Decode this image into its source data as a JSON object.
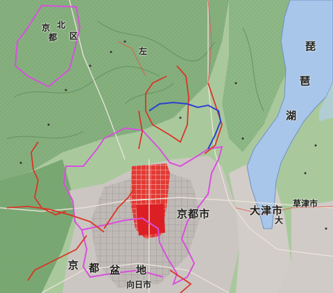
{
  "map": {
    "labels": {
      "kyoto_city": "京都市",
      "otsu_city": "大津市",
      "muko_city": "向日市",
      "kusatsu": "草津市",
      "kita": "北",
      "kyo": "京",
      "to": "都",
      "ku": "区",
      "sakyo": "左",
      "biwa1": "琵",
      "biwa2": "琶",
      "biwa3": "湖",
      "lake_otsu": "大",
      "nishikyo1": "京",
      "nishikyo2": "都",
      "nishikyo3": "盆",
      "nishikyo4": "地"
    },
    "colors": {
      "forest": "#7fae78",
      "ridge": "#5d8d5a",
      "lake": "#a9c8ea",
      "urban": "#c8c4c0",
      "kyoto_border": "#d84fdd",
      "route_red": "#d93425",
      "route_blue": "#2c3fcf",
      "city_red": "#e0262a"
    },
    "icons": [
      "road-network",
      "ward-boundary",
      "water-body"
    ]
  }
}
